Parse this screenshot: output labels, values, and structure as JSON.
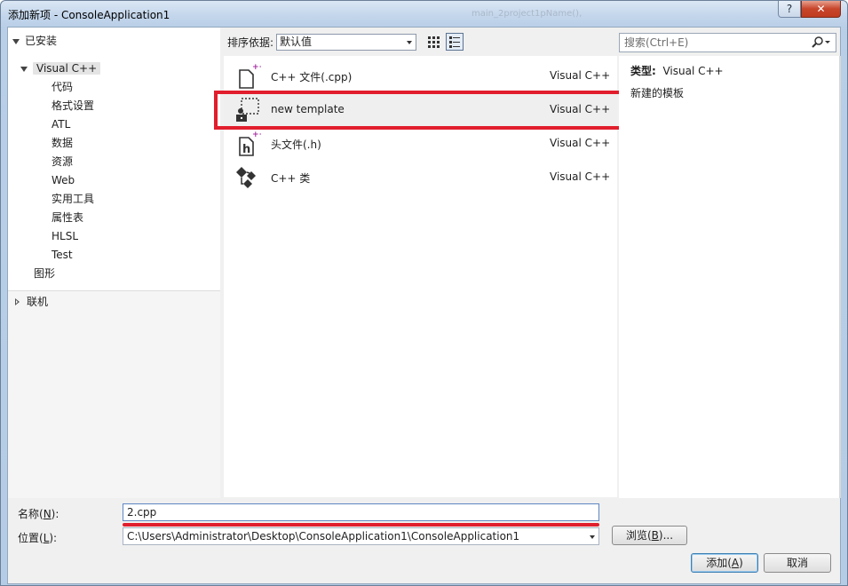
{
  "window": {
    "title": "添加新项 - ConsoleApplication1",
    "ghost_tab": "main_2project1pName(),",
    "help_label": "?",
    "close_label": "✕"
  },
  "left_pane": {
    "installed_label": "已安装",
    "root_label": "Visual C++",
    "children": [
      "代码",
      "格式设置",
      "ATL",
      "数据",
      "资源",
      "Web",
      "实用工具",
      "属性表",
      "HLSL",
      "Test"
    ],
    "graphics_label": "图形",
    "online_label": "联机"
  },
  "toolbar": {
    "sort_label": "排序依据:",
    "sort_value": "默认值"
  },
  "items": [
    {
      "name": "C++ 文件(.cpp)",
      "lang": "Visual C++",
      "icon": "cpp-file-icon"
    },
    {
      "name": "new template",
      "lang": "Visual C++",
      "icon": "template-icon"
    },
    {
      "name": "头文件(.h)",
      "lang": "Visual C++",
      "icon": "header-file-icon"
    },
    {
      "name": "C++ 类",
      "lang": "Visual C++",
      "icon": "class-icon"
    }
  ],
  "search": {
    "placeholder": "搜索(Ctrl+E)"
  },
  "details": {
    "type_label": "类型:",
    "type_value": "Visual C++",
    "description": "新建的模板"
  },
  "form": {
    "name_label_prefix": "名称(",
    "name_label_key": "N",
    "name_label_suffix": "):",
    "name_value": "2.cpp",
    "location_label_prefix": "位置(",
    "location_label_key": "L",
    "location_label_suffix": "):",
    "location_value": "C:\\Users\\Administrator\\Desktop\\ConsoleApplication1\\ConsoleApplication1",
    "browse_prefix": "浏览(",
    "browse_key": "B",
    "browse_suffix": ")...",
    "add_prefix": "添加(",
    "add_key": "A",
    "add_suffix": ")",
    "cancel_label": "取消"
  },
  "colors": {
    "highlight": "#e11e2d",
    "accent": "#3c7fb1",
    "cpp_plus": "#a52fa1"
  }
}
